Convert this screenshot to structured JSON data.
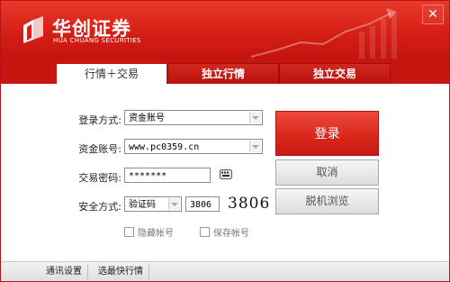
{
  "brand": {
    "name_cn": "华创证券",
    "name_en": "HUA CHUANG SECURITIES"
  },
  "window": {
    "close_glyph": "✕"
  },
  "tabs": [
    {
      "label": "行情＋交易",
      "active": true
    },
    {
      "label": "独立行情",
      "active": false
    },
    {
      "label": "独立交易",
      "active": false
    }
  ],
  "form": {
    "login_method": {
      "label": "登录方式:",
      "value": "资金账号"
    },
    "account": {
      "label": "资金账号:",
      "value": "www.pc0359.cn"
    },
    "password": {
      "label": "交易密码:",
      "value": "*******"
    },
    "security": {
      "label": "安全方式:",
      "method": "验证码",
      "code_value": "3806",
      "captcha_text": "3806"
    },
    "hide_account": {
      "label": "隐藏帐号",
      "checked": false
    },
    "save_account": {
      "label": "保存帐号",
      "checked": false
    }
  },
  "buttons": {
    "login": "登录",
    "cancel": "取消",
    "offline": "脱机浏览"
  },
  "footer": {
    "comm_settings": "通讯设置",
    "fastest_market": "选最快行情"
  },
  "colors": {
    "brand_red": "#d61f16",
    "dark_red": "#c7160f"
  },
  "icons": {
    "close": "close-icon",
    "keyboard": "keyboard-icon",
    "combo_arrow": "chevron-down-icon"
  }
}
